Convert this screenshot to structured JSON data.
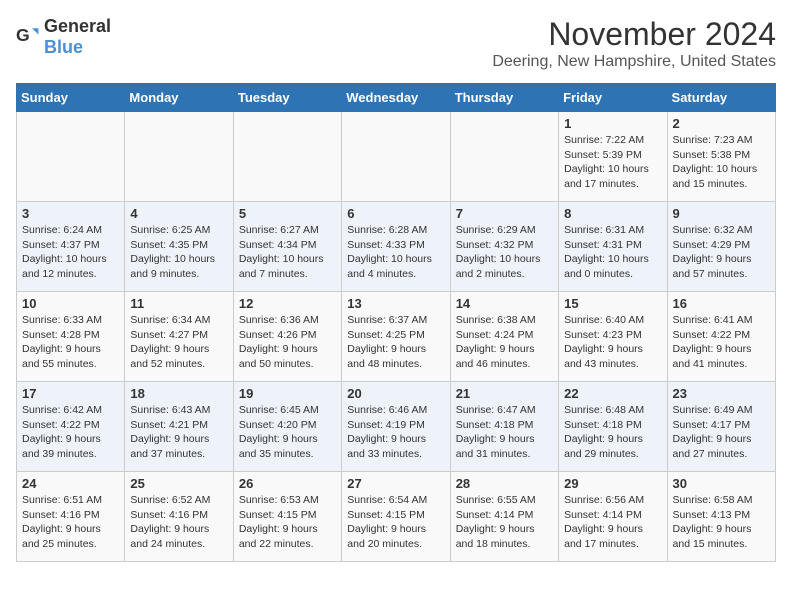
{
  "header": {
    "logo_general": "General",
    "logo_blue": "Blue",
    "title": "November 2024",
    "subtitle": "Deering, New Hampshire, United States"
  },
  "columns": [
    "Sunday",
    "Monday",
    "Tuesday",
    "Wednesday",
    "Thursday",
    "Friday",
    "Saturday"
  ],
  "weeks": [
    [
      {
        "day": "",
        "info": ""
      },
      {
        "day": "",
        "info": ""
      },
      {
        "day": "",
        "info": ""
      },
      {
        "day": "",
        "info": ""
      },
      {
        "day": "",
        "info": ""
      },
      {
        "day": "1",
        "info": "Sunrise: 7:22 AM\nSunset: 5:39 PM\nDaylight: 10 hours and 17 minutes."
      },
      {
        "day": "2",
        "info": "Sunrise: 7:23 AM\nSunset: 5:38 PM\nDaylight: 10 hours and 15 minutes."
      }
    ],
    [
      {
        "day": "3",
        "info": "Sunrise: 6:24 AM\nSunset: 4:37 PM\nDaylight: 10 hours and 12 minutes."
      },
      {
        "day": "4",
        "info": "Sunrise: 6:25 AM\nSunset: 4:35 PM\nDaylight: 10 hours and 9 minutes."
      },
      {
        "day": "5",
        "info": "Sunrise: 6:27 AM\nSunset: 4:34 PM\nDaylight: 10 hours and 7 minutes."
      },
      {
        "day": "6",
        "info": "Sunrise: 6:28 AM\nSunset: 4:33 PM\nDaylight: 10 hours and 4 minutes."
      },
      {
        "day": "7",
        "info": "Sunrise: 6:29 AM\nSunset: 4:32 PM\nDaylight: 10 hours and 2 minutes."
      },
      {
        "day": "8",
        "info": "Sunrise: 6:31 AM\nSunset: 4:31 PM\nDaylight: 10 hours and 0 minutes."
      },
      {
        "day": "9",
        "info": "Sunrise: 6:32 AM\nSunset: 4:29 PM\nDaylight: 9 hours and 57 minutes."
      }
    ],
    [
      {
        "day": "10",
        "info": "Sunrise: 6:33 AM\nSunset: 4:28 PM\nDaylight: 9 hours and 55 minutes."
      },
      {
        "day": "11",
        "info": "Sunrise: 6:34 AM\nSunset: 4:27 PM\nDaylight: 9 hours and 52 minutes."
      },
      {
        "day": "12",
        "info": "Sunrise: 6:36 AM\nSunset: 4:26 PM\nDaylight: 9 hours and 50 minutes."
      },
      {
        "day": "13",
        "info": "Sunrise: 6:37 AM\nSunset: 4:25 PM\nDaylight: 9 hours and 48 minutes."
      },
      {
        "day": "14",
        "info": "Sunrise: 6:38 AM\nSunset: 4:24 PM\nDaylight: 9 hours and 46 minutes."
      },
      {
        "day": "15",
        "info": "Sunrise: 6:40 AM\nSunset: 4:23 PM\nDaylight: 9 hours and 43 minutes."
      },
      {
        "day": "16",
        "info": "Sunrise: 6:41 AM\nSunset: 4:22 PM\nDaylight: 9 hours and 41 minutes."
      }
    ],
    [
      {
        "day": "17",
        "info": "Sunrise: 6:42 AM\nSunset: 4:22 PM\nDaylight: 9 hours and 39 minutes."
      },
      {
        "day": "18",
        "info": "Sunrise: 6:43 AM\nSunset: 4:21 PM\nDaylight: 9 hours and 37 minutes."
      },
      {
        "day": "19",
        "info": "Sunrise: 6:45 AM\nSunset: 4:20 PM\nDaylight: 9 hours and 35 minutes."
      },
      {
        "day": "20",
        "info": "Sunrise: 6:46 AM\nSunset: 4:19 PM\nDaylight: 9 hours and 33 minutes."
      },
      {
        "day": "21",
        "info": "Sunrise: 6:47 AM\nSunset: 4:18 PM\nDaylight: 9 hours and 31 minutes."
      },
      {
        "day": "22",
        "info": "Sunrise: 6:48 AM\nSunset: 4:18 PM\nDaylight: 9 hours and 29 minutes."
      },
      {
        "day": "23",
        "info": "Sunrise: 6:49 AM\nSunset: 4:17 PM\nDaylight: 9 hours and 27 minutes."
      }
    ],
    [
      {
        "day": "24",
        "info": "Sunrise: 6:51 AM\nSunset: 4:16 PM\nDaylight: 9 hours and 25 minutes."
      },
      {
        "day": "25",
        "info": "Sunrise: 6:52 AM\nSunset: 4:16 PM\nDaylight: 9 hours and 24 minutes."
      },
      {
        "day": "26",
        "info": "Sunrise: 6:53 AM\nSunset: 4:15 PM\nDaylight: 9 hours and 22 minutes."
      },
      {
        "day": "27",
        "info": "Sunrise: 6:54 AM\nSunset: 4:15 PM\nDaylight: 9 hours and 20 minutes."
      },
      {
        "day": "28",
        "info": "Sunrise: 6:55 AM\nSunset: 4:14 PM\nDaylight: 9 hours and 18 minutes."
      },
      {
        "day": "29",
        "info": "Sunrise: 6:56 AM\nSunset: 4:14 PM\nDaylight: 9 hours and 17 minutes."
      },
      {
        "day": "30",
        "info": "Sunrise: 6:58 AM\nSunset: 4:13 PM\nDaylight: 9 hours and 15 minutes."
      }
    ]
  ]
}
